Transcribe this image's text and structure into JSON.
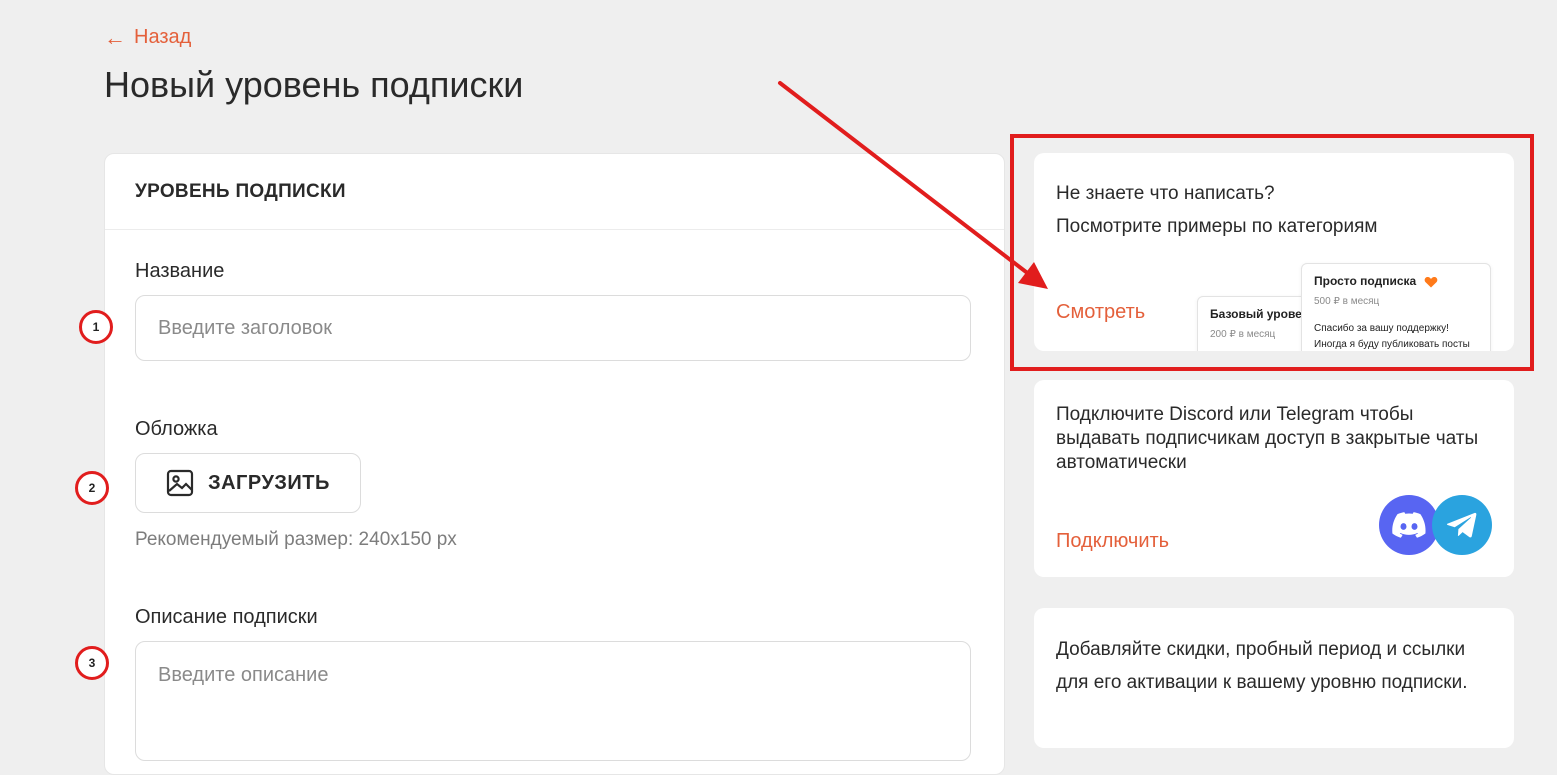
{
  "header": {
    "back_label": "Назад",
    "title": "Новый уровень подписки"
  },
  "form": {
    "section_title": "УРОВЕНЬ ПОДПИСКИ",
    "name": {
      "label": "Название",
      "placeholder": "Введите заголовок",
      "value": ""
    },
    "cover": {
      "label": "Обложка",
      "upload_label": "ЗАГРУЗИТЬ",
      "hint": "Рекомендуемый размер: 240x150 px"
    },
    "description": {
      "label": "Описание подписки",
      "placeholder": "Введите описание",
      "value": ""
    }
  },
  "markers": [
    "1",
    "2",
    "3"
  ],
  "sidebar": {
    "examples": {
      "line1": "Не знаете что написать?",
      "line2": "Посмотрите примеры по категориям",
      "link": "Смотреть",
      "preview_cards": [
        {
          "title": "Базовый уровень",
          "price": "200 ₽ в месяц"
        },
        {
          "title": "Просто подписка",
          "price": "500 ₽ в месяц",
          "desc_line1": "Спасибо за вашу поддержку!",
          "desc_line2": "Иногда я буду публиковать посты"
        }
      ]
    },
    "connect": {
      "text": "Подключите Discord или Telegram чтобы выдавать подписчикам доступ в закрытые чаты автоматически",
      "link": "Подключить",
      "icons": [
        "discord-icon",
        "telegram-icon"
      ]
    },
    "promo": {
      "text": "Добавляйте скидки, пробный период и ссылки для его активации к вашему уровню подписки."
    }
  },
  "colors": {
    "accent": "#e4603b",
    "annotation": "#e11d1d",
    "background": "#efefef",
    "discord": "#5865f2",
    "telegram": "#2aa3df",
    "heart": "#ff7a1a"
  }
}
